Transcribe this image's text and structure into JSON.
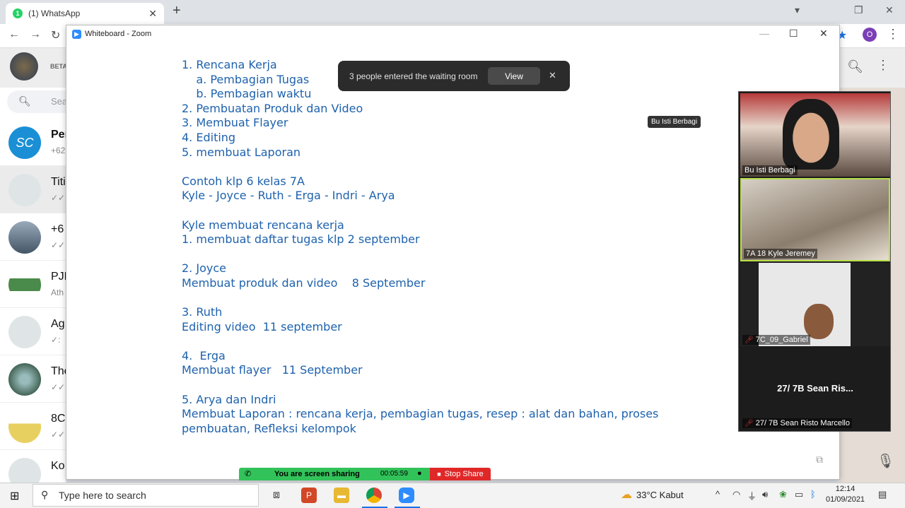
{
  "browser": {
    "tab_title": "(1) WhatsApp",
    "tab_badge": "1",
    "profile_initial": "O"
  },
  "whatsapp": {
    "header_label": "BETA",
    "search_placeholder": "Sea",
    "chats": [
      {
        "name": "Per",
        "sub": "+62"
      },
      {
        "name": "Titi",
        "sub": "✓✓"
      },
      {
        "name": "+6",
        "sub": "✓✓"
      },
      {
        "name": "PJE",
        "sub": "Ath"
      },
      {
        "name": "Ag",
        "sub": "✓:"
      },
      {
        "name": "The",
        "sub": "✓✓"
      },
      {
        "name": "8C",
        "sub": "✓✓"
      },
      {
        "name": "Ko",
        "sub": ""
      }
    ]
  },
  "zoom": {
    "window_title": "Whiteboard - Zoom",
    "whiteboard_text": "1. Rencana Kerja\n    a. Pembagian Tugas\n    b. Pembagian waktu\n2. Pembuatan Produk dan Video\n3. Membuat Flayer\n4. Editing\n5. membuat Laporan\n\nContoh klp 6 kelas 7A\nKyle - Joyce - Ruth - Erga - Indri - Arya\n\nKyle membuat rencana kerja\n1. membuat daftar tugas klp 2 september\n\n2. Joyce\nMembuat produk dan video    8 September\n\n3. Ruth\nEditing video  11 september\n\n4.  Erga\nMembuat flayer   11 September\n\n5. Arya dan Indri\nMembuat Laporan : rencana kerja, pembagian tugas, resep : alat dan bahan, proses\npembuatan, Refleksi kelompok",
    "toast": {
      "message": "3 people entered the waiting room",
      "view_label": "View"
    },
    "tooltip": "Bu Isti Berbagi",
    "participants": [
      {
        "label": "Bu Isti Berbagi"
      },
      {
        "label": "7A 18 Kyle Jeremey"
      },
      {
        "label": "7C_09_Gabriel"
      },
      {
        "label": "27/ 7B  Sean Risto Marcello",
        "display_name": "27/ 7B  Sean Ris..."
      }
    ],
    "share_bar": {
      "text": "You are screen sharing",
      "timer": "00:05:59",
      "stop_label": "Stop Share"
    }
  },
  "taskbar": {
    "search_placeholder": "Type here to search",
    "weather": "33°C  Kabut",
    "time": "12:14",
    "date": "01/09/2021"
  }
}
